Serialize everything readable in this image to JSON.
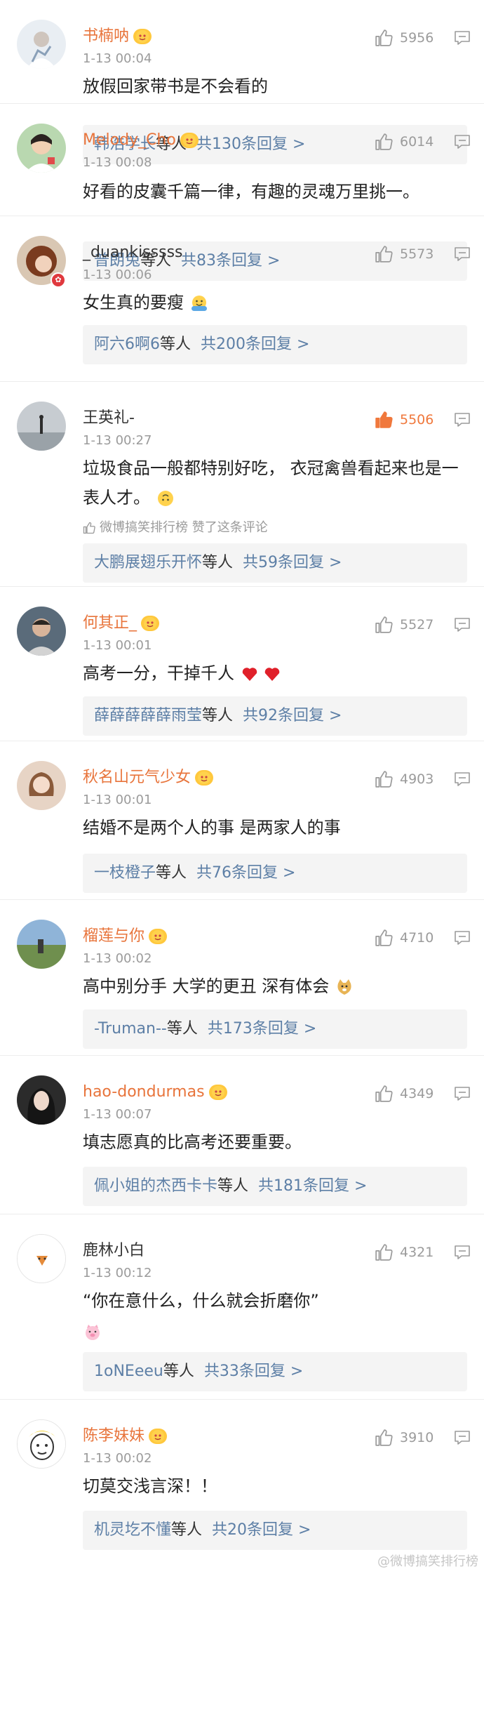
{
  "comments": [
    {
      "name": "书楠呐",
      "vip": true,
      "time": "1-13 00:04",
      "likes": "5956",
      "liked": false,
      "text": "放假回家带书是不会看的",
      "reply_user": "韩浩学长",
      "reply_mid": "等人",
      "reply_count": "共130条回复 >",
      "avatar": "avatar-1"
    },
    {
      "name": "Melody_Cho",
      "vip": true,
      "time": "1-13 00:08",
      "likes": "6014",
      "liked": false,
      "text": "好看的皮囊千篇一律，有趣的灵魂万里挑一。",
      "reply_user": "普朗兔",
      "reply_mid": "等人",
      "reply_count": "共83条回复 >",
      "avatar": "avatar-2"
    },
    {
      "name": "_duankisssss",
      "vip": false,
      "time": "1-13 00:06",
      "likes": "5573",
      "liked": false,
      "text": "女生真的要瘦",
      "emoji": "hugging-emoji-icon",
      "reply_user": "阿六6啊6",
      "reply_mid": "等人",
      "reply_count": "共200条回复 >",
      "avatar": "avatar-3"
    },
    {
      "name": "王英礼-",
      "vip": false,
      "time": "1-13 00:27",
      "likes": "5506",
      "liked": true,
      "text": "垃圾食品一般都特别好吃，  衣冠禽兽看起来也是一表人才。",
      "emoji": "upside-down-face-emoji-icon",
      "liked_by": "微博搞笑排行榜 赞了这条评论",
      "reply_user": "大鹏展翅乐开怀",
      "reply_mid": "等人",
      "reply_count": "共59条回复 >",
      "avatar": "avatar-4"
    },
    {
      "name": "何其正_",
      "vip": true,
      "time": "1-13 00:01",
      "likes": "5527",
      "liked": false,
      "text": "高考一分，干掉千人",
      "emoji": "two-hearts-emoji-icon",
      "reply_user": "薛薛薛薛薛雨莹",
      "reply_mid": "等人",
      "reply_count": "共92条回复 >",
      "avatar": "avatar-5"
    },
    {
      "name": "秋名山元气少女",
      "vip": true,
      "time": "1-13 00:01",
      "likes": "4903",
      "liked": false,
      "text": "结婚不是两个人的事 是两家人的事",
      "reply_user": "一枝橙子",
      "reply_mid": "等人",
      "reply_count": "共76条回复 >",
      "avatar": "avatar-6"
    },
    {
      "name": "榴莲与你",
      "vip": true,
      "time": "1-13 00:02",
      "likes": "4710",
      "liked": false,
      "text": "高中别分手 大学的更丑 深有体会",
      "emoji": "doge-emoji-icon",
      "reply_user": "-Truman--",
      "reply_mid": "等人",
      "reply_count": "共173条回复 >",
      "avatar": "avatar-7"
    },
    {
      "name": "hao-dondurmas",
      "vip": true,
      "time": "1-13 00:07",
      "likes": "4349",
      "liked": false,
      "text": "填志愿真的比高考还要重要。",
      "reply_user": "佩小姐的杰西卡卡",
      "reply_mid": "等人",
      "reply_count": "共181条回复 >",
      "avatar": "avatar-8"
    },
    {
      "name": "鹿林小白",
      "vip": false,
      "time": "1-13 00:12",
      "likes": "4321",
      "liked": false,
      "text": "“你在意什么，什么就会折磨你”",
      "emoji": "pig-emoji-icon",
      "reply_user": "1oNEeeu",
      "reply_mid": "等人",
      "reply_count": "共33条回复 >",
      "avatar": "avatar-9"
    },
    {
      "name": "陈李妹妹",
      "vip": true,
      "time": "1-13 00:02",
      "likes": "3910",
      "liked": false,
      "text": "切莫交浅言深！！",
      "reply_user": "机灵圪不懂",
      "reply_mid": "等人",
      "reply_count": "共20条回复 >",
      "avatar": "avatar-10"
    }
  ],
  "watermark": "@微博搞笑排行榜",
  "colors": {
    "vip_name": "#e8743b",
    "link": "#5d7fa6",
    "meta": "#9b9b9b",
    "liked": "#f0783c",
    "reply_bg": "#f4f4f4"
  }
}
